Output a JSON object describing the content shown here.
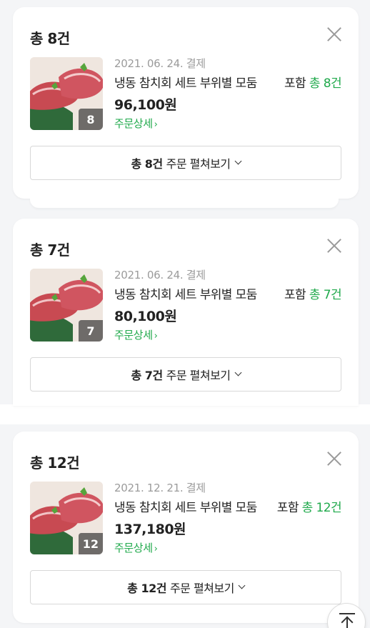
{
  "orders": [
    {
      "count_label": "총 8건",
      "thumb_count": "8",
      "date_label": "2021. 06. 24. 결제",
      "product_name": "냉동 참치회 세트 부위별 모둠",
      "include_prefix": "포함 ",
      "include_count": "총 8건",
      "price": "96,100원",
      "detail_label": "주문상세",
      "detail_chevron": "›",
      "expand_strong": "총 8건",
      "expand_rest": "주문 펼쳐보기"
    },
    {
      "count_label": "총 7건",
      "thumb_count": "7",
      "date_label": "2021. 06. 24. 결제",
      "product_name": "냉동 참치회 세트 부위별 모둠",
      "include_prefix": "포함 ",
      "include_count": "총 7건",
      "price": "80,100원",
      "detail_label": "주문상세",
      "detail_chevron": "›",
      "expand_strong": "총 7건",
      "expand_rest": "주문 펼쳐보기"
    },
    {
      "count_label": "총 12건",
      "thumb_count": "12",
      "date_label": "2021. 12. 21. 결제",
      "product_name": "냉동 참치회 세트 부위별 모둠",
      "include_prefix": "포함 ",
      "include_count": "총 12건",
      "price": "137,180원",
      "detail_label": "주문상세",
      "detail_chevron": "›",
      "expand_strong": "총 12건",
      "expand_rest": "주문 펼쳐보기"
    }
  ],
  "colors": {
    "accent_green": "#1fa94b",
    "page_background": "#f4f5f7",
    "card_background": "#ffffff"
  },
  "icons": {
    "close": "close-icon",
    "chevron_right": "chevron-right-icon",
    "chevron_down": "chevron-down-icon",
    "scroll_top": "arrow-up-to-top-icon"
  }
}
